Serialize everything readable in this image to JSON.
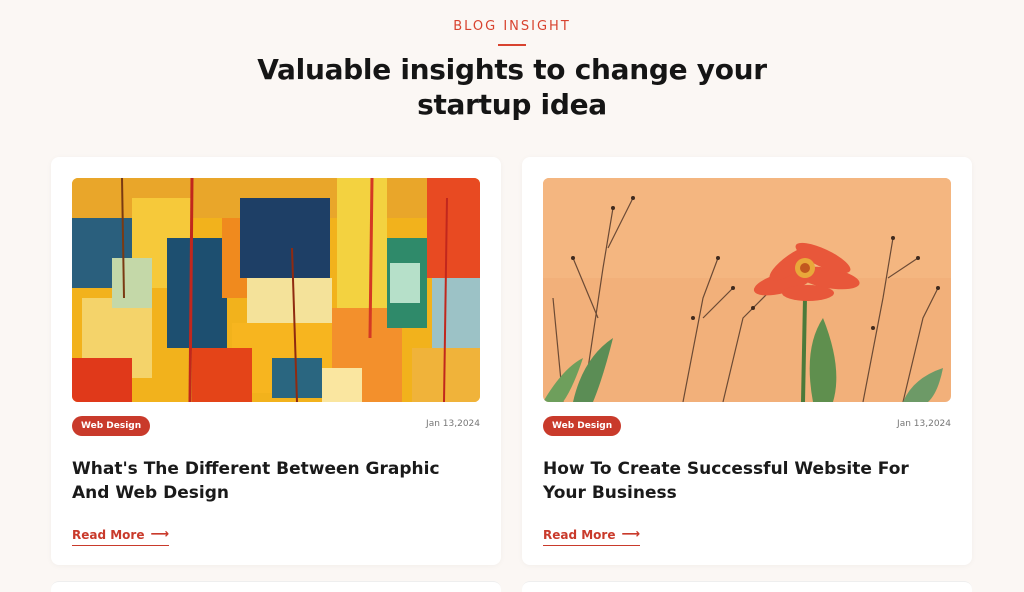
{
  "section": {
    "eyebrow": "BLOG INSIGHT",
    "headline": "Valuable insights to change your startup idea"
  },
  "posts": [
    {
      "image": "abstract-painting-image",
      "tag": "Web Design",
      "date": "Jan 13,2024",
      "title": "What's The Different Between Graphic And Web Design",
      "read_more": "Read More"
    },
    {
      "image": "red-flower-image",
      "tag": "Web Design",
      "date": "Jan 13,2024",
      "title": "How To Create Successful Website For Your Business",
      "read_more": "Read More"
    }
  ],
  "icons": {
    "read_more_arrow": "arrow-right-icon"
  },
  "colors": {
    "accent": "#c93a2b",
    "eyebrow": "#d8432f",
    "background": "#fbf7f4"
  }
}
